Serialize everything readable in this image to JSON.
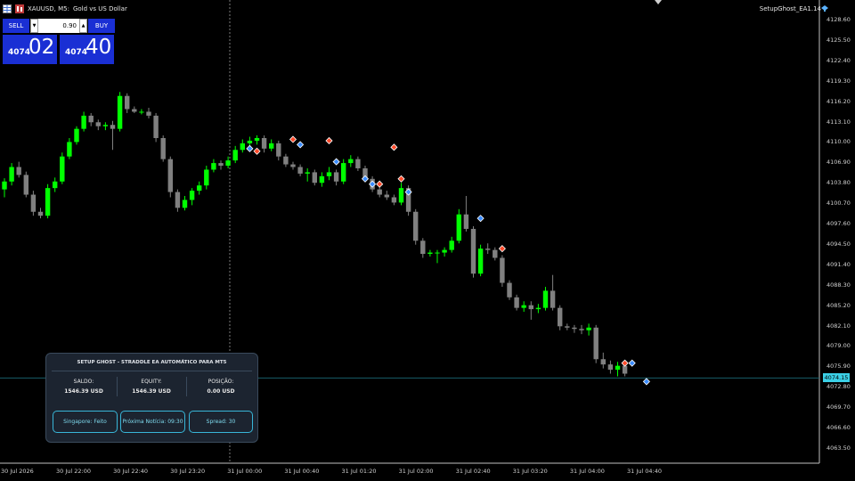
{
  "titlebar": {
    "symbol": "XAUUSD, M5:",
    "description": "Gold vs US Dollar"
  },
  "ea_label": "SetupGhost_EA1.14",
  "trade_panel": {
    "sell_label": "SELL",
    "buy_label": "BUY",
    "lot_value": "0.90",
    "sell_price_small": "4074",
    "sell_price_big": "02",
    "buy_price_small": "4074",
    "buy_price_big": "40"
  },
  "info_panel": {
    "title": "SETUP GHOST - STRADDLE EA AUTOMÁTICO PARA MT5",
    "saldo_label": "SALDO:",
    "saldo_value": "1546.39 USD",
    "equity_label": "EQUITY:",
    "equity_value": "1546.39 USD",
    "posicao_label": "POSIÇÃO:",
    "posicao_value": "0.00 USD",
    "btn_singapore": "Singapore: Feito",
    "btn_news": "Próxima Notícia: 09:30",
    "btn_spread": "Spread: 30"
  },
  "price_axis": {
    "ticks": [
      "4128.60",
      "4125.50",
      "4122.40",
      "4119.30",
      "4116.20",
      "4113.10",
      "4110.00",
      "4106.90",
      "4103.80",
      "4100.70",
      "4097.60",
      "4094.50",
      "4091.40",
      "4088.30",
      "4085.20",
      "4082.10",
      "4079.00",
      "4075.90",
      "4072.80",
      "4069.70",
      "4066.60",
      "4063.50"
    ],
    "current_price": "4074.15"
  },
  "time_axis": [
    "30 Jul 2026",
    "30 Jul 22:00",
    "30 Jul 22:40",
    "30 Jul 23:20",
    "31 Jul 00:00",
    "31 Jul 00:40",
    "31 Jul 01:20",
    "31 Jul 02:00",
    "31 Jul 02:40",
    "31 Jul 03:20",
    "31 Jul 04:00",
    "31 Jul 04:40"
  ],
  "colors": {
    "bull": "#00ff00",
    "bear": "#808080",
    "panel_accent": "#38b6d8",
    "button_blue": "#1a2fd4",
    "price_line": "#1b6b78"
  },
  "chart_data": {
    "type": "candlestick",
    "symbol": "XAUUSD",
    "timeframe": "M5",
    "ylim": [
      4062.0,
      4130.0
    ],
    "candles": [
      {
        "o": 4102.8,
        "h": 4104.5,
        "l": 4101.6,
        "c": 4104.0
      },
      {
        "o": 4104.0,
        "h": 4106.8,
        "l": 4103.4,
        "c": 4106.2
      },
      {
        "o": 4106.2,
        "h": 4107.0,
        "l": 4104.6,
        "c": 4105.0
      },
      {
        "o": 4105.0,
        "h": 4105.5,
        "l": 4101.6,
        "c": 4102.0
      },
      {
        "o": 4102.0,
        "h": 4102.6,
        "l": 4098.8,
        "c": 4099.4
      },
      {
        "o": 4099.4,
        "h": 4100.0,
        "l": 4098.4,
        "c": 4098.8
      },
      {
        "o": 4098.8,
        "h": 4103.6,
        "l": 4098.4,
        "c": 4103.0
      },
      {
        "o": 4103.0,
        "h": 4104.6,
        "l": 4102.4,
        "c": 4104.0
      },
      {
        "o": 4104.0,
        "h": 4108.4,
        "l": 4103.6,
        "c": 4107.8
      },
      {
        "o": 4107.8,
        "h": 4110.6,
        "l": 4107.4,
        "c": 4110.0
      },
      {
        "o": 4110.0,
        "h": 4112.4,
        "l": 4109.6,
        "c": 4112.0
      },
      {
        "o": 4112.0,
        "h": 4114.6,
        "l": 4111.6,
        "c": 4114.0
      },
      {
        "o": 4114.0,
        "h": 4114.4,
        "l": 4112.4,
        "c": 4113.0
      },
      {
        "o": 4113.0,
        "h": 4113.4,
        "l": 4111.8,
        "c": 4112.4
      },
      {
        "o": 4112.4,
        "h": 4113.0,
        "l": 4111.8,
        "c": 4112.6
      },
      {
        "o": 4112.6,
        "h": 4113.2,
        "l": 4108.8,
        "c": 4112.0
      },
      {
        "o": 4112.0,
        "h": 4117.6,
        "l": 4111.6,
        "c": 4117.0
      },
      {
        "o": 4117.0,
        "h": 4117.4,
        "l": 4114.4,
        "c": 4115.0
      },
      {
        "o": 4115.0,
        "h": 4115.4,
        "l": 4114.4,
        "c": 4114.6
      },
      {
        "o": 4114.6,
        "h": 4115.0,
        "l": 4114.2,
        "c": 4114.6
      },
      {
        "o": 4114.6,
        "h": 4115.2,
        "l": 4113.6,
        "c": 4114.0
      },
      {
        "o": 4114.0,
        "h": 4114.4,
        "l": 4110.0,
        "c": 4110.6
      },
      {
        "o": 4110.6,
        "h": 4111.0,
        "l": 4107.0,
        "c": 4107.4
      },
      {
        "o": 4107.4,
        "h": 4107.8,
        "l": 4101.6,
        "c": 4102.4
      },
      {
        "o": 4102.4,
        "h": 4102.8,
        "l": 4099.4,
        "c": 4100.0
      },
      {
        "o": 4100.0,
        "h": 4101.8,
        "l": 4099.6,
        "c": 4101.2
      },
      {
        "o": 4101.2,
        "h": 4103.0,
        "l": 4100.4,
        "c": 4102.6
      },
      {
        "o": 4102.6,
        "h": 4104.0,
        "l": 4102.0,
        "c": 4103.4
      },
      {
        "o": 4103.4,
        "h": 4106.4,
        "l": 4102.8,
        "c": 4105.8
      },
      {
        "o": 4105.8,
        "h": 4107.4,
        "l": 4105.4,
        "c": 4106.8
      },
      {
        "o": 4106.8,
        "h": 4107.2,
        "l": 4105.8,
        "c": 4106.4
      },
      {
        "o": 4106.4,
        "h": 4107.8,
        "l": 4106.0,
        "c": 4107.2
      },
      {
        "o": 4107.2,
        "h": 4109.4,
        "l": 4106.8,
        "c": 4108.8
      },
      {
        "o": 4108.8,
        "h": 4110.4,
        "l": 4108.4,
        "c": 4109.8
      },
      {
        "o": 4109.8,
        "h": 4110.8,
        "l": 4109.2,
        "c": 4110.2
      },
      {
        "o": 4110.2,
        "h": 4111.0,
        "l": 4109.6,
        "c": 4110.6
      },
      {
        "o": 4110.6,
        "h": 4111.0,
        "l": 4108.4,
        "c": 4109.0
      },
      {
        "o": 4109.0,
        "h": 4110.4,
        "l": 4108.6,
        "c": 4109.8
      },
      {
        "o": 4109.8,
        "h": 4110.2,
        "l": 4107.2,
        "c": 4107.8
      },
      {
        "o": 4107.8,
        "h": 4108.2,
        "l": 4106.2,
        "c": 4106.6
      },
      {
        "o": 4106.6,
        "h": 4107.0,
        "l": 4105.8,
        "c": 4106.2
      },
      {
        "o": 4106.2,
        "h": 4106.6,
        "l": 4104.8,
        "c": 4105.2
      },
      {
        "o": 4105.2,
        "h": 4106.0,
        "l": 4104.0,
        "c": 4105.4
      },
      {
        "o": 4105.4,
        "h": 4105.8,
        "l": 4103.4,
        "c": 4103.8
      },
      {
        "o": 4103.8,
        "h": 4105.4,
        "l": 4103.2,
        "c": 4104.8
      },
      {
        "o": 4104.8,
        "h": 4106.2,
        "l": 4104.2,
        "c": 4105.4
      },
      {
        "o": 4105.4,
        "h": 4105.8,
        "l": 4103.4,
        "c": 4104.0
      },
      {
        "o": 4104.0,
        "h": 4107.4,
        "l": 4103.6,
        "c": 4106.8
      },
      {
        "o": 4106.8,
        "h": 4108.0,
        "l": 4106.2,
        "c": 4107.4
      },
      {
        "o": 4107.4,
        "h": 4107.8,
        "l": 4105.6,
        "c": 4106.0
      },
      {
        "o": 4106.0,
        "h": 4106.4,
        "l": 4104.0,
        "c": 4104.4
      },
      {
        "o": 4104.4,
        "h": 4104.8,
        "l": 4102.4,
        "c": 4102.8
      },
      {
        "o": 4102.8,
        "h": 4103.4,
        "l": 4101.6,
        "c": 4102.0
      },
      {
        "o": 4102.0,
        "h": 4102.6,
        "l": 4101.2,
        "c": 4101.6
      },
      {
        "o": 4101.6,
        "h": 4102.0,
        "l": 4100.4,
        "c": 4100.8
      },
      {
        "o": 4100.8,
        "h": 4103.8,
        "l": 4100.4,
        "c": 4103.0
      },
      {
        "o": 4103.0,
        "h": 4103.4,
        "l": 4098.8,
        "c": 4099.4
      },
      {
        "o": 4099.4,
        "h": 4099.8,
        "l": 4094.4,
        "c": 4095.0
      },
      {
        "o": 4095.0,
        "h": 4095.4,
        "l": 4092.4,
        "c": 4093.0
      },
      {
        "o": 4093.0,
        "h": 4093.6,
        "l": 4092.6,
        "c": 4093.2
      },
      {
        "o": 4093.2,
        "h": 4093.6,
        "l": 4091.6,
        "c": 4093.2
      },
      {
        "o": 4093.2,
        "h": 4094.0,
        "l": 4092.6,
        "c": 4093.6
      },
      {
        "o": 4093.6,
        "h": 4095.6,
        "l": 4093.2,
        "c": 4095.0
      },
      {
        "o": 4095.0,
        "h": 4099.8,
        "l": 4094.6,
        "c": 4099.0
      },
      {
        "o": 4099.0,
        "h": 4101.8,
        "l": 4096.4,
        "c": 4096.8
      },
      {
        "o": 4096.8,
        "h": 4097.2,
        "l": 4089.4,
        "c": 4090.0
      },
      {
        "o": 4090.0,
        "h": 4094.4,
        "l": 4089.6,
        "c": 4093.8
      },
      {
        "o": 4093.8,
        "h": 4094.6,
        "l": 4093.0,
        "c": 4093.6
      },
      {
        "o": 4093.6,
        "h": 4094.0,
        "l": 4092.0,
        "c": 4092.4
      },
      {
        "o": 4092.4,
        "h": 4092.8,
        "l": 4088.0,
        "c": 4088.6
      },
      {
        "o": 4088.6,
        "h": 4089.0,
        "l": 4086.0,
        "c": 4086.4
      },
      {
        "o": 4086.4,
        "h": 4086.8,
        "l": 4084.4,
        "c": 4084.8
      },
      {
        "o": 4084.8,
        "h": 4085.8,
        "l": 4084.2,
        "c": 4085.2
      },
      {
        "o": 4085.2,
        "h": 4085.8,
        "l": 4083.0,
        "c": 4084.6
      },
      {
        "o": 4084.6,
        "h": 4085.4,
        "l": 4084.0,
        "c": 4084.8
      },
      {
        "o": 4084.8,
        "h": 4088.0,
        "l": 4084.4,
        "c": 4087.4
      },
      {
        "o": 4087.4,
        "h": 4089.8,
        "l": 4084.4,
        "c": 4084.8
      },
      {
        "o": 4084.8,
        "h": 4085.2,
        "l": 4081.4,
        "c": 4082.0
      },
      {
        "o": 4082.0,
        "h": 4082.4,
        "l": 4081.4,
        "c": 4081.8
      },
      {
        "o": 4081.8,
        "h": 4082.2,
        "l": 4081.0,
        "c": 4081.6
      },
      {
        "o": 4081.6,
        "h": 4082.2,
        "l": 4080.8,
        "c": 4081.4
      },
      {
        "o": 4081.4,
        "h": 4082.4,
        "l": 4080.6,
        "c": 4081.8
      },
      {
        "o": 4081.8,
        "h": 4082.2,
        "l": 4076.4,
        "c": 4077.0
      },
      {
        "o": 4077.0,
        "h": 4078.0,
        "l": 4075.6,
        "c": 4076.2
      },
      {
        "o": 4076.2,
        "h": 4076.8,
        "l": 4074.8,
        "c": 4075.4
      },
      {
        "o": 4075.4,
        "h": 4076.6,
        "l": 4074.4,
        "c": 4076.0
      },
      {
        "o": 4076.0,
        "h": 4076.4,
        "l": 4074.4,
        "c": 4074.8
      }
    ],
    "markers": [
      {
        "i": 34,
        "p": 4109.0,
        "kind": "buy"
      },
      {
        "i": 35,
        "p": 4108.6,
        "kind": "sell"
      },
      {
        "i": 40,
        "p": 4110.4,
        "kind": "sell"
      },
      {
        "i": 41,
        "p": 4109.6,
        "kind": "buy"
      },
      {
        "i": 45,
        "p": 4110.2,
        "kind": "sell"
      },
      {
        "i": 46,
        "p": 4107.0,
        "kind": "buy"
      },
      {
        "i": 50,
        "p": 4104.4,
        "kind": "buy"
      },
      {
        "i": 51,
        "p": 4103.6,
        "kind": "buy"
      },
      {
        "i": 52,
        "p": 4103.6,
        "kind": "sell"
      },
      {
        "i": 54,
        "p": 4109.2,
        "kind": "sell"
      },
      {
        "i": 55,
        "p": 4104.4,
        "kind": "sell"
      },
      {
        "i": 56,
        "p": 4102.4,
        "kind": "buy"
      },
      {
        "i": 66,
        "p": 4098.4,
        "kind": "buy"
      },
      {
        "i": 69,
        "p": 4093.8,
        "kind": "sell"
      },
      {
        "i": 86,
        "p": 4076.4,
        "kind": "sell"
      },
      {
        "i": 87,
        "p": 4076.4,
        "kind": "buy"
      },
      {
        "i": 89,
        "p": 4073.6,
        "kind": "buy"
      }
    ]
  }
}
